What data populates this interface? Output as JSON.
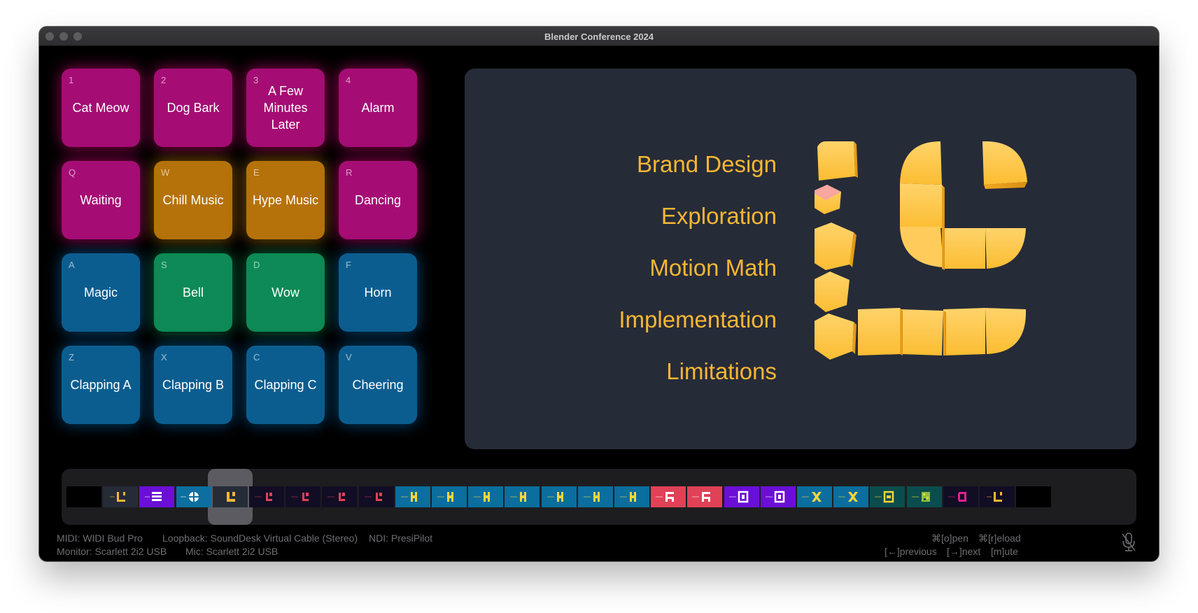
{
  "window": {
    "title": "Blender Conference 2024"
  },
  "pads": [
    {
      "key": "1",
      "label": "Cat Meow",
      "color": "magenta"
    },
    {
      "key": "2",
      "label": "Dog Bark",
      "color": "magenta"
    },
    {
      "key": "3",
      "label": "A Few Minutes Later",
      "color": "magenta"
    },
    {
      "key": "4",
      "label": "Alarm",
      "color": "magenta"
    },
    {
      "key": "Q",
      "label": "Waiting",
      "color": "magenta"
    },
    {
      "key": "W",
      "label": "Chill Music",
      "color": "orange"
    },
    {
      "key": "E",
      "label": "Hype Music",
      "color": "orange"
    },
    {
      "key": "R",
      "label": "Dancing",
      "color": "magenta"
    },
    {
      "key": "A",
      "label": "Magic",
      "color": "blue"
    },
    {
      "key": "S",
      "label": "Bell",
      "color": "green"
    },
    {
      "key": "D",
      "label": "Wow",
      "color": "green"
    },
    {
      "key": "F",
      "label": "Horn",
      "color": "blue"
    },
    {
      "key": "Z",
      "label": "Clapping A",
      "color": "blue"
    },
    {
      "key": "X",
      "label": "Clapping B",
      "color": "blue"
    },
    {
      "key": "C",
      "label": "Clapping C",
      "color": "blue"
    },
    {
      "key": "V",
      "label": "Cheering",
      "color": "blue"
    }
  ],
  "slide": {
    "topics": [
      "Brand Design",
      "Exploration",
      "Motion Math",
      "Implementation",
      "Limitations"
    ],
    "accent": "#f7b733",
    "background": "#262b38"
  },
  "filmstrip": {
    "selected_index": 4,
    "thumbs": [
      {
        "bg": "#000000",
        "icon": "none"
      },
      {
        "bg": "#262b38",
        "icon": "logo-outline-icon"
      },
      {
        "bg": "#6b0fd6",
        "icon": "bars-icon"
      },
      {
        "bg": "#0d6fa0",
        "icon": "plus-ring-icon"
      },
      {
        "bg": "#262b38",
        "icon": "logo-icon"
      },
      {
        "bg": "#110d24",
        "icon": "corner-icon"
      },
      {
        "bg": "#110d24",
        "icon": "corner-icon"
      },
      {
        "bg": "#110d24",
        "icon": "corner-icon"
      },
      {
        "bg": "#110d24",
        "icon": "corner-icon"
      },
      {
        "bg": "#0b6e9e",
        "icon": "split-icon"
      },
      {
        "bg": "#0b6e9e",
        "icon": "split-icon"
      },
      {
        "bg": "#0b6e9e",
        "icon": "split-icon"
      },
      {
        "bg": "#0b6e9e",
        "icon": "split-icon"
      },
      {
        "bg": "#0b6e9e",
        "icon": "split-icon"
      },
      {
        "bg": "#0b6e9e",
        "icon": "split-icon"
      },
      {
        "bg": "#0b6e9e",
        "icon": "split-icon"
      },
      {
        "bg": "#e04156",
        "icon": "grid-icon"
      },
      {
        "bg": "#e04156",
        "icon": "grid-icon"
      },
      {
        "bg": "#6b0fd6",
        "icon": "frame-icon"
      },
      {
        "bg": "#6b0fd6",
        "icon": "frame-icon"
      },
      {
        "bg": "#0b6e9e",
        "icon": "x-icon"
      },
      {
        "bg": "#0b6e9e",
        "icon": "x-icon"
      },
      {
        "bg": "#0b4d4d",
        "icon": "box-icon"
      },
      {
        "bg": "#0b4d4d",
        "icon": "pixel-icon"
      },
      {
        "bg": "#110d24",
        "icon": "bracket-icon"
      },
      {
        "bg": "#110d24",
        "icon": "logo-outline-icon"
      },
      {
        "bg": "#000000",
        "icon": "none"
      }
    ]
  },
  "status": {
    "midi": "MIDI: WIDI Bud Pro",
    "loopback": "Loopback: SoundDesk Virtual Cable (Stereo)",
    "ndi": "NDI: PresiPilot",
    "monitor": "Monitor: Scarlett 2i2 USB",
    "mic": "Mic: Scarlett 2i2 USB",
    "open": "⌘[o]pen",
    "reload": "⌘[r]eload",
    "previous": "[←]previous",
    "next": "[→]next",
    "mute": "[m]ute"
  }
}
